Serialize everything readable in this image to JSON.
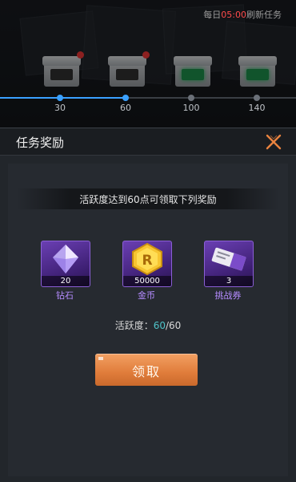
{
  "background": {
    "refresh_prefix": "每日",
    "refresh_time": "05:00",
    "refresh_suffix": "刷新任务",
    "milestones": [
      "30",
      "60",
      "100",
      "140"
    ]
  },
  "dialog": {
    "title": "任务奖励",
    "subtitle": "活跃度达到60点可领取下列奖励",
    "rewards": [
      {
        "name": "钻石",
        "qty": "20",
        "icon": "diamond-icon"
      },
      {
        "name": "金币",
        "qty": "50000",
        "icon": "gold-coin-icon"
      },
      {
        "name": "挑战券",
        "qty": "3",
        "icon": "challenge-ticket-icon"
      }
    ],
    "activity_label": "活跃度：",
    "activity_current": "60",
    "activity_sep": "/",
    "activity_total": "60",
    "claim_label": "领取"
  },
  "colors": {
    "accent_cyan": "#4fc3c8",
    "claim_orange": "#e07c3a",
    "close_orange": "#e9833f",
    "reward_purple": "#b58cff",
    "refresh_red": "#ff4b4b"
  }
}
